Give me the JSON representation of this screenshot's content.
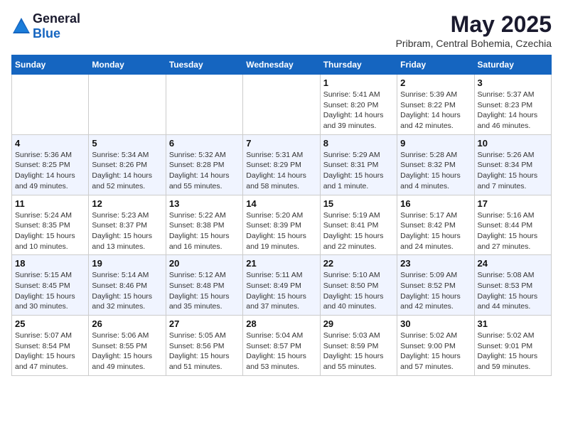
{
  "logo": {
    "general": "General",
    "blue": "Blue"
  },
  "title": "May 2025",
  "subtitle": "Pribram, Central Bohemia, Czechia",
  "days_of_week": [
    "Sunday",
    "Monday",
    "Tuesday",
    "Wednesday",
    "Thursday",
    "Friday",
    "Saturday"
  ],
  "weeks": [
    [
      {
        "day": "",
        "info": ""
      },
      {
        "day": "",
        "info": ""
      },
      {
        "day": "",
        "info": ""
      },
      {
        "day": "",
        "info": ""
      },
      {
        "day": "1",
        "info": "Sunrise: 5:41 AM\nSunset: 8:20 PM\nDaylight: 14 hours\nand 39 minutes."
      },
      {
        "day": "2",
        "info": "Sunrise: 5:39 AM\nSunset: 8:22 PM\nDaylight: 14 hours\nand 42 minutes."
      },
      {
        "day": "3",
        "info": "Sunrise: 5:37 AM\nSunset: 8:23 PM\nDaylight: 14 hours\nand 46 minutes."
      }
    ],
    [
      {
        "day": "4",
        "info": "Sunrise: 5:36 AM\nSunset: 8:25 PM\nDaylight: 14 hours\nand 49 minutes."
      },
      {
        "day": "5",
        "info": "Sunrise: 5:34 AM\nSunset: 8:26 PM\nDaylight: 14 hours\nand 52 minutes."
      },
      {
        "day": "6",
        "info": "Sunrise: 5:32 AM\nSunset: 8:28 PM\nDaylight: 14 hours\nand 55 minutes."
      },
      {
        "day": "7",
        "info": "Sunrise: 5:31 AM\nSunset: 8:29 PM\nDaylight: 14 hours\nand 58 minutes."
      },
      {
        "day": "8",
        "info": "Sunrise: 5:29 AM\nSunset: 8:31 PM\nDaylight: 15 hours\nand 1 minute."
      },
      {
        "day": "9",
        "info": "Sunrise: 5:28 AM\nSunset: 8:32 PM\nDaylight: 15 hours\nand 4 minutes."
      },
      {
        "day": "10",
        "info": "Sunrise: 5:26 AM\nSunset: 8:34 PM\nDaylight: 15 hours\nand 7 minutes."
      }
    ],
    [
      {
        "day": "11",
        "info": "Sunrise: 5:24 AM\nSunset: 8:35 PM\nDaylight: 15 hours\nand 10 minutes."
      },
      {
        "day": "12",
        "info": "Sunrise: 5:23 AM\nSunset: 8:37 PM\nDaylight: 15 hours\nand 13 minutes."
      },
      {
        "day": "13",
        "info": "Sunrise: 5:22 AM\nSunset: 8:38 PM\nDaylight: 15 hours\nand 16 minutes."
      },
      {
        "day": "14",
        "info": "Sunrise: 5:20 AM\nSunset: 8:39 PM\nDaylight: 15 hours\nand 19 minutes."
      },
      {
        "day": "15",
        "info": "Sunrise: 5:19 AM\nSunset: 8:41 PM\nDaylight: 15 hours\nand 22 minutes."
      },
      {
        "day": "16",
        "info": "Sunrise: 5:17 AM\nSunset: 8:42 PM\nDaylight: 15 hours\nand 24 minutes."
      },
      {
        "day": "17",
        "info": "Sunrise: 5:16 AM\nSunset: 8:44 PM\nDaylight: 15 hours\nand 27 minutes."
      }
    ],
    [
      {
        "day": "18",
        "info": "Sunrise: 5:15 AM\nSunset: 8:45 PM\nDaylight: 15 hours\nand 30 minutes."
      },
      {
        "day": "19",
        "info": "Sunrise: 5:14 AM\nSunset: 8:46 PM\nDaylight: 15 hours\nand 32 minutes."
      },
      {
        "day": "20",
        "info": "Sunrise: 5:12 AM\nSunset: 8:48 PM\nDaylight: 15 hours\nand 35 minutes."
      },
      {
        "day": "21",
        "info": "Sunrise: 5:11 AM\nSunset: 8:49 PM\nDaylight: 15 hours\nand 37 minutes."
      },
      {
        "day": "22",
        "info": "Sunrise: 5:10 AM\nSunset: 8:50 PM\nDaylight: 15 hours\nand 40 minutes."
      },
      {
        "day": "23",
        "info": "Sunrise: 5:09 AM\nSunset: 8:52 PM\nDaylight: 15 hours\nand 42 minutes."
      },
      {
        "day": "24",
        "info": "Sunrise: 5:08 AM\nSunset: 8:53 PM\nDaylight: 15 hours\nand 44 minutes."
      }
    ],
    [
      {
        "day": "25",
        "info": "Sunrise: 5:07 AM\nSunset: 8:54 PM\nDaylight: 15 hours\nand 47 minutes."
      },
      {
        "day": "26",
        "info": "Sunrise: 5:06 AM\nSunset: 8:55 PM\nDaylight: 15 hours\nand 49 minutes."
      },
      {
        "day": "27",
        "info": "Sunrise: 5:05 AM\nSunset: 8:56 PM\nDaylight: 15 hours\nand 51 minutes."
      },
      {
        "day": "28",
        "info": "Sunrise: 5:04 AM\nSunset: 8:57 PM\nDaylight: 15 hours\nand 53 minutes."
      },
      {
        "day": "29",
        "info": "Sunrise: 5:03 AM\nSunset: 8:59 PM\nDaylight: 15 hours\nand 55 minutes."
      },
      {
        "day": "30",
        "info": "Sunrise: 5:02 AM\nSunset: 9:00 PM\nDaylight: 15 hours\nand 57 minutes."
      },
      {
        "day": "31",
        "info": "Sunrise: 5:02 AM\nSunset: 9:01 PM\nDaylight: 15 hours\nand 59 minutes."
      }
    ]
  ]
}
